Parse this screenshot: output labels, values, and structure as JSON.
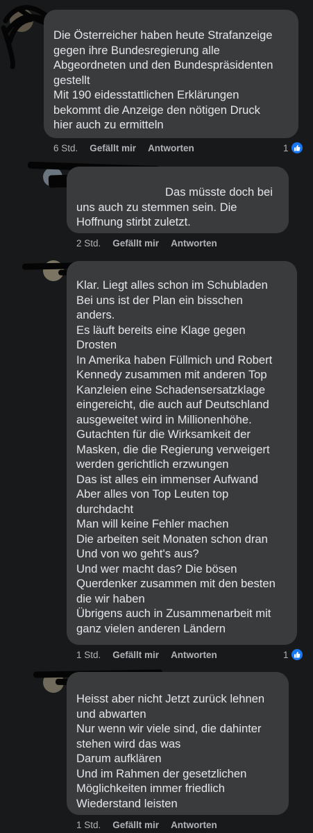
{
  "comments": [
    {
      "lines": [
        "Die Österreicher haben heute Strafanzeige",
        "gegen ihre Bundesregierung alle",
        "Abgeordneten und den Bundespräsidenten",
        "gestellt",
        "Mit 190 eidesstattlichen Erklärungen",
        "bekommt die Anzeige den nötigen Druck",
        "hier auch zu ermitteln"
      ],
      "time": "6 Std.",
      "like_label": "Gefällt mir",
      "reply_label": "Antworten",
      "reaction_count": "1"
    },
    {
      "lines": [
        "Das müsste doch bei",
        "uns auch zu stemmen sein. Die",
        "Hoffnung stirbt zuletzt."
      ],
      "time": "2 Std.",
      "like_label": "Gefällt mir",
      "reply_label": "Antworten"
    },
    {
      "lines": [
        "Klar. Liegt alles schon im Schubladen",
        "Bei uns ist der Plan ein bisschen",
        "anders.",
        "Es läuft bereits eine Klage gegen",
        "Drosten",
        "In Amerika haben Füllmich und Robert",
        "Kennedy zusammen mit anderen Top",
        "Kanzleien eine Schadensersatzklage",
        "eingereicht, die auch auf Deutschland",
        "ausgeweitet wird in Millionenhöhe.",
        "Gutachten für die Wirksamkeit der",
        "Masken, die die Regierung verweigert",
        "werden gerichtlich erzwungen",
        "Das ist alles ein immenser Aufwand",
        "Aber alles von Top Leuten top",
        "durchdacht",
        "Man will keine Fehler machen",
        "Die arbeiten seit Monaten schon dran",
        "Und von wo geht's aus?",
        "Und wer macht das? Die bösen",
        "Querdenker zusammen mit den besten",
        "die wir haben",
        "Übrigens auch in Zusammenarbeit mit",
        "ganz vielen anderen Ländern"
      ],
      "time": "1 Std.",
      "like_label": "Gefällt mir",
      "reply_label": "Antworten",
      "reaction_count": "1"
    },
    {
      "lines": [
        "Heisst aber nicht Jetzt zurück lehnen",
        "und abwarten",
        "Nur wenn wir viele sind, die dahinter",
        "stehen wird das was",
        "Darum aufklären",
        "Und im Rahmen der gesetzlichen",
        "Möglichkeiten immer friedlich",
        "Wiederstand leisten"
      ],
      "time": "1 Std.",
      "like_label": "Gefällt mir",
      "reply_label": "Antworten"
    }
  ],
  "colors": {
    "background": "#18191a",
    "bubble": "#3a3b3c",
    "text": "#e4e6eb",
    "meta": "#b0b3b8",
    "like_badge": "#1877f2"
  },
  "icons": {
    "reaction": "thumbs-up-icon"
  }
}
